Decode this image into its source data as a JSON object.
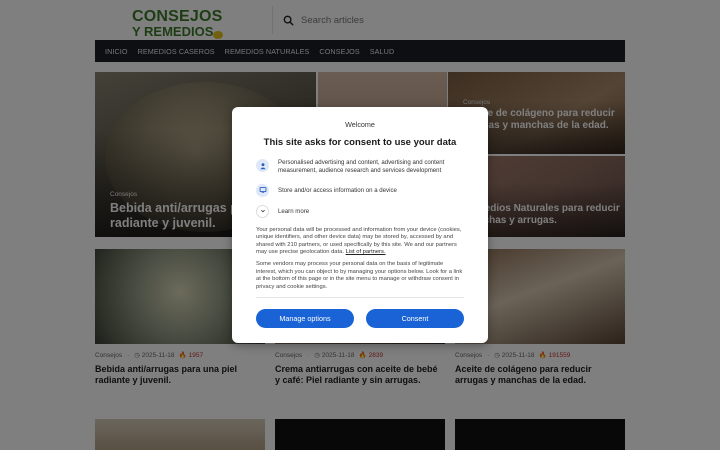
{
  "header": {
    "logo_line1": "CONSEJOS",
    "logo_line2": "Y REMEDIOS",
    "search_placeholder": "Search articles",
    "search_icon": "search-icon"
  },
  "nav": {
    "items": [
      "INICIO",
      "REMEDIOS CASEROS",
      "REMEDIOS NATURALES",
      "CONSEJOS",
      "SALUD"
    ]
  },
  "featured": [
    {
      "category": "Consejos",
      "title": "Bebida anti/arrugas para una piel radiante y juvenil."
    },
    {
      "category": "Consejos",
      "title": "Aceite de colágeno para reducir arrugas y manchas de la edad."
    },
    {
      "category": "",
      "title": "Remedios Naturales para reducir manchas y arrugas."
    }
  ],
  "cards": [
    {
      "category": "Consejos",
      "date": "2025-11-18",
      "views": "1957",
      "title": "Bebida anti/arrugas para una piel radiante y juvenil."
    },
    {
      "category": "Consejos",
      "date": "2025-11-18",
      "views": "2839",
      "title": "Crema antiarrugas con aceite de bebé y café: Piel radiante y sin arrugas."
    },
    {
      "category": "Consejos",
      "date": "2025-11-18",
      "views": "191559",
      "title": "Aceite de colágeno para reducir arrugas y manchas de la edad."
    }
  ],
  "consent": {
    "welcome": "Welcome",
    "title": "This site asks for consent to use your data",
    "purpose_1": "Personalised advertising and content, advertising and content measurement, audience research and services development",
    "purpose_2": "Store and/or access information on a device",
    "learn_more": "Learn more",
    "paragraph_1": "Your personal data will be processed and information from your device (cookies, unique identifiers, and other device data) may be stored by, accessed by and shared with 210 partners, or used specifically by this site. We and our partners may use precise geolocation data.",
    "partners_link": "List of partners.",
    "paragraph_2": "Some vendors may process your personal data on the basis of legitimate interest, which you can object to by managing your options below. Look for a link at the bottom of this page or in the site menu to manage or withdraw consent in privacy and cookie settings.",
    "manage_label": "Manage options",
    "consent_label": "Consent"
  },
  "colors": {
    "brand_green": "#3c7a2a",
    "nav_bg": "#1c1f24",
    "button_blue": "#1a63d6",
    "views_red": "#c0312b"
  }
}
